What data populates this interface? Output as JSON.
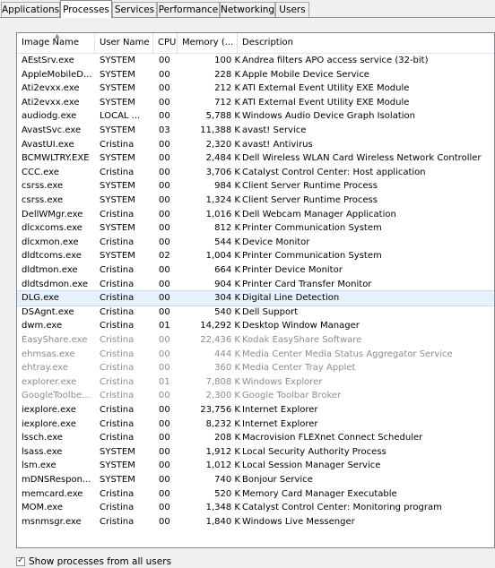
{
  "tabs": [
    {
      "label": "Applications"
    },
    {
      "label": "Processes"
    },
    {
      "label": "Services"
    },
    {
      "label": "Performance"
    },
    {
      "label": "Networking"
    },
    {
      "label": "Users"
    }
  ],
  "columns": {
    "image_name": "Image Name",
    "user_name": "User Name",
    "cpu": "CPU",
    "memory": "Memory (...",
    "description": "Description"
  },
  "rows": [
    {
      "name": "AEstSrv.exe",
      "user": "SYSTEM",
      "cpu": "00",
      "mem": "100 K",
      "desc": "Andrea filters APO access service (32-bit)"
    },
    {
      "name": "AppleMobileD...",
      "user": "SYSTEM",
      "cpu": "00",
      "mem": "228 K",
      "desc": "Apple Mobile Device Service"
    },
    {
      "name": "Ati2evxx.exe",
      "user": "SYSTEM",
      "cpu": "00",
      "mem": "212 K",
      "desc": "ATI External Event Utility EXE Module"
    },
    {
      "name": "Ati2evxx.exe",
      "user": "SYSTEM",
      "cpu": "00",
      "mem": "712 K",
      "desc": "ATI External Event Utility EXE Module"
    },
    {
      "name": "audiodg.exe",
      "user": "LOCAL ...",
      "cpu": "00",
      "mem": "5,788 K",
      "desc": "Windows Audio Device Graph Isolation"
    },
    {
      "name": "AvastSvc.exe",
      "user": "SYSTEM",
      "cpu": "03",
      "mem": "11,388 K",
      "desc": "avast! Service"
    },
    {
      "name": "AvastUI.exe",
      "user": "Cristina",
      "cpu": "00",
      "mem": "2,320 K",
      "desc": "avast! Antivirus"
    },
    {
      "name": "BCMWLTRY.EXE",
      "user": "SYSTEM",
      "cpu": "00",
      "mem": "2,484 K",
      "desc": "Dell Wireless WLAN Card Wireless Network Controller"
    },
    {
      "name": "CCC.exe",
      "user": "Cristina",
      "cpu": "00",
      "mem": "3,706 K",
      "desc": "Catalyst Control Center: Host application"
    },
    {
      "name": "csrss.exe",
      "user": "SYSTEM",
      "cpu": "00",
      "mem": "984 K",
      "desc": "Client Server Runtime Process"
    },
    {
      "name": "csrss.exe",
      "user": "SYSTEM",
      "cpu": "00",
      "mem": "1,324 K",
      "desc": "Client Server Runtime Process"
    },
    {
      "name": "DellWMgr.exe",
      "user": "Cristina",
      "cpu": "00",
      "mem": "1,016 K",
      "desc": "Dell Webcam Manager Application"
    },
    {
      "name": "dlcxcoms.exe",
      "user": "SYSTEM",
      "cpu": "00",
      "mem": "812 K",
      "desc": "Printer Communication System"
    },
    {
      "name": "dlcxmon.exe",
      "user": "Cristina",
      "cpu": "00",
      "mem": "544 K",
      "desc": "Device Monitor"
    },
    {
      "name": "dldtcoms.exe",
      "user": "SYSTEM",
      "cpu": "02",
      "mem": "1,004 K",
      "desc": "Printer Communication System"
    },
    {
      "name": "dldtmon.exe",
      "user": "Cristina",
      "cpu": "00",
      "mem": "664 K",
      "desc": "Printer Device Monitor"
    },
    {
      "name": "dldtsdmon.exe",
      "user": "Cristina",
      "cpu": "00",
      "mem": "904 K",
      "desc": "Printer Card Transfer Monitor"
    },
    {
      "name": "DLG.exe",
      "user": "Cristina",
      "cpu": "00",
      "mem": "304 K",
      "desc": "Digital Line Detection"
    },
    {
      "name": "DSAgnt.exe",
      "user": "Cristina",
      "cpu": "00",
      "mem": "540 K",
      "desc": "Dell Support"
    },
    {
      "name": "dwm.exe",
      "user": "Cristina",
      "cpu": "01",
      "mem": "14,292 K",
      "desc": "Desktop Window Manager"
    },
    {
      "name": "EasyShare.exe",
      "user": "Cristina",
      "cpu": "00",
      "mem": "22,436 K",
      "desc": "Kodak EasyShare Software"
    },
    {
      "name": "ehmsas.exe",
      "user": "Cristina",
      "cpu": "00",
      "mem": "444 K",
      "desc": "Media Center Media Status Aggregator Service"
    },
    {
      "name": "ehtray.exe",
      "user": "Cristina",
      "cpu": "00",
      "mem": "360 K",
      "desc": "Media Center Tray Applet"
    },
    {
      "name": "explorer.exe",
      "user": "Cristina",
      "cpu": "01",
      "mem": "7,808 K",
      "desc": "Windows Explorer"
    },
    {
      "name": "GoogleToolbe...",
      "user": "Cristina",
      "cpu": "00",
      "mem": "2,300 K",
      "desc": "Google Toolbar Broker"
    },
    {
      "name": "iexplore.exe",
      "user": "Cristina",
      "cpu": "00",
      "mem": "23,756 K",
      "desc": "Internet Explorer"
    },
    {
      "name": "iexplore.exe",
      "user": "Cristina",
      "cpu": "00",
      "mem": "8,232 K",
      "desc": "Internet Explorer"
    },
    {
      "name": "lssch.exe",
      "user": "Cristina",
      "cpu": "00",
      "mem": "208 K",
      "desc": "Macrovision FLEXnet Connect Scheduler"
    },
    {
      "name": "lsass.exe",
      "user": "SYSTEM",
      "cpu": "00",
      "mem": "1,912 K",
      "desc": "Local Security Authority Process"
    },
    {
      "name": "lsm.exe",
      "user": "SYSTEM",
      "cpu": "00",
      "mem": "1,012 K",
      "desc": "Local Session Manager Service"
    },
    {
      "name": "mDNSRespon...",
      "user": "SYSTEM",
      "cpu": "00",
      "mem": "740 K",
      "desc": "Bonjour Service"
    },
    {
      "name": "memcard.exe",
      "user": "Cristina",
      "cpu": "00",
      "mem": "520 K",
      "desc": "Memory Card Manager Executable"
    },
    {
      "name": "MOM.exe",
      "user": "Cristina",
      "cpu": "00",
      "mem": "1,348 K",
      "desc": "Catalyst Control Center: Monitoring program"
    },
    {
      "name": "msnmsgr.exe",
      "user": "Cristina",
      "cpu": "00",
      "mem": "1,840 K",
      "desc": "Windows Live Messenger"
    }
  ],
  "footer": {
    "show_all_label": "Show processes from all users"
  }
}
